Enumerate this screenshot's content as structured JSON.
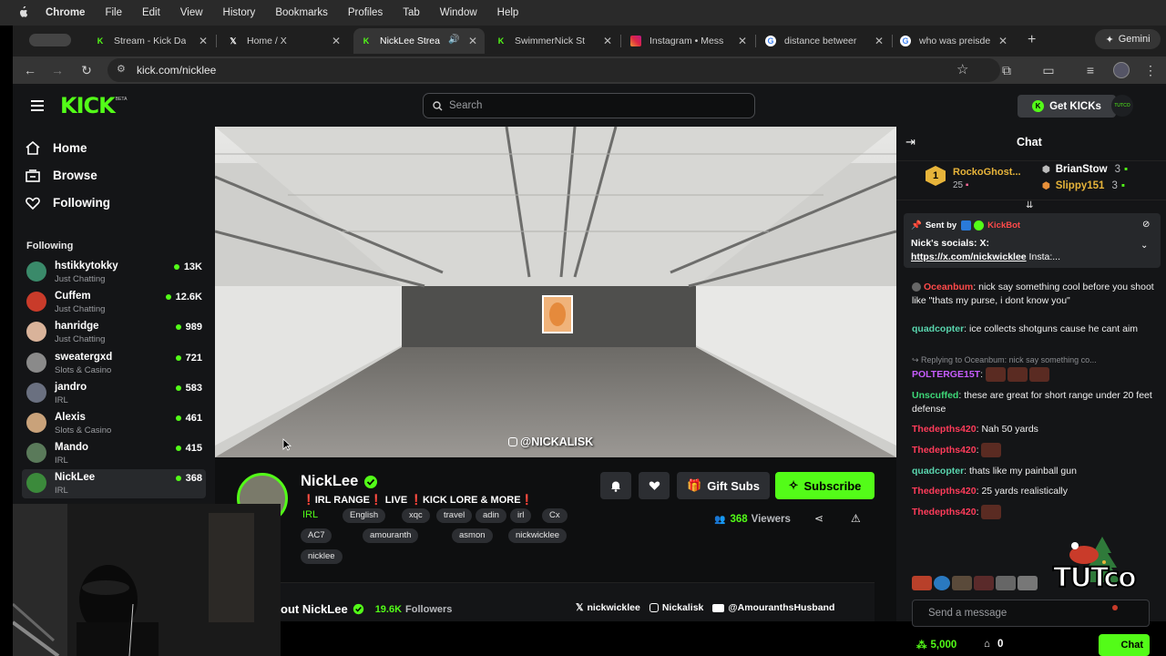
{
  "menubar": {
    "items": [
      "Chrome",
      "File",
      "Edit",
      "View",
      "History",
      "Bookmarks",
      "Profiles",
      "Tab",
      "Window",
      "Help"
    ]
  },
  "tabs": [
    {
      "title": "Stream - Kick Da",
      "icon": "kick-icon"
    },
    {
      "title": "Home / X",
      "icon": "x-icon"
    },
    {
      "title": "NickLee Strea",
      "icon": "kick-icon",
      "active": true
    },
    {
      "title": "SwimmerNick St",
      "icon": "kick-icon"
    },
    {
      "title": "Instagram • Mess",
      "icon": "instagram-icon"
    },
    {
      "title": "distance betweer",
      "icon": "google-icon"
    },
    {
      "title": "who was preisde",
      "icon": "google-icon"
    }
  ],
  "browser": {
    "url": "kick.com/nicklee",
    "gemini_label": "Gemini"
  },
  "header": {
    "logo": "KICK",
    "logo_sup": "BETA",
    "search_placeholder": "Search",
    "get_kicks": "Get KICKs",
    "avatar_text": "TUTCO"
  },
  "sidebar": {
    "nav": [
      {
        "label": "Home",
        "icon": "home-icon"
      },
      {
        "label": "Browse",
        "icon": "browse-icon"
      },
      {
        "label": "Following",
        "icon": "heart-icon"
      }
    ],
    "following_heading": "Following",
    "following": [
      {
        "name": "hstikkytokky",
        "category": "Just Chatting",
        "viewers": "13K",
        "color": "#3a8a6a"
      },
      {
        "name": "Cuffem",
        "category": "Just Chatting",
        "viewers": "12.6K",
        "color": "#c93b2a"
      },
      {
        "name": "hanridge",
        "category": "Just Chatting",
        "viewers": "989",
        "color": "#d9b39a"
      },
      {
        "name": "sweatergxd",
        "category": "Slots & Casino",
        "viewers": "721",
        "color": "#8a8a8a"
      },
      {
        "name": "jandro",
        "category": "IRL",
        "viewers": "583",
        "color": "#6a7080"
      },
      {
        "name": "Alexis",
        "category": "Slots & Casino",
        "viewers": "461",
        "color": "#c9a27a"
      },
      {
        "name": "Mando",
        "category": "IRL",
        "viewers": "415",
        "color": "#5a7a5a"
      },
      {
        "name": "NickLee",
        "category": "IRL",
        "viewers": "368",
        "color": "#3b8a3b",
        "selected": true
      }
    ]
  },
  "video": {
    "watermark": "@NICKALISK"
  },
  "channel": {
    "name": "NickLee",
    "title_parts": [
      "❗",
      "IRL RANGE",
      "❗",
      " LIVE ",
      "❗",
      "KICK LORE & MORE",
      "❗"
    ],
    "category": "IRL",
    "tags": [
      "English",
      "xqc",
      "travel",
      "adin",
      "irl",
      "Cx",
      "AC7",
      "amouranth",
      "asmon",
      "nickwicklee",
      "nicklee"
    ],
    "gift_subs": "Gift Subs",
    "subscribe": "Subscribe",
    "viewers": "368",
    "viewers_label": "Viewers",
    "about_label": "out NickLee",
    "followers": "19.6K",
    "followers_label": "Followers",
    "socials": [
      {
        "icon": "x-icon",
        "handle": "nickwicklee"
      },
      {
        "icon": "instagram-icon",
        "handle": "Nickalisk"
      },
      {
        "icon": "youtube-icon",
        "handle": "@AmouranthsHusband"
      }
    ]
  },
  "chat": {
    "title": "Chat",
    "leaderboard": {
      "rank": "1",
      "top_user": "RockoGhost...",
      "top_count": "25",
      "users": [
        {
          "name": "BrianStow",
          "count": "3"
        },
        {
          "name": "Slippy151",
          "count": "3"
        }
      ]
    },
    "pinned": {
      "sent_by": "Sent by",
      "bot": "KickBot",
      "line1": "Nick's socials: X:",
      "link": "https://x.com/nickwicklee",
      "line2_rest": " Insta:..."
    },
    "messages": [
      {
        "user": "Oceanbum",
        "color": "#ff4a4a",
        "text": "nick say something cool before you shoot like \"thats my purse, i dont know you\""
      },
      {
        "user": "quadcopter",
        "color": "#59d5ae",
        "text": "ice collects shotguns cause he cant aim"
      },
      {
        "reply": "Replying to Oceanbum: nick say something co...",
        "user": "POLTERGE15T",
        "color": "#c65cff",
        "text": ""
      },
      {
        "user": "Unscuffed",
        "color": "#3ed878",
        "text": "these are great for short range under 20 feet  defense"
      },
      {
        "user": "Thedepths420",
        "color": "#ff3c5a",
        "text": "Nah 50 yards"
      },
      {
        "user": "Thedepths420",
        "color": "#ff3c5a",
        "text": ""
      },
      {
        "user": "quadcopter",
        "color": "#59d5ae",
        "text": "thats like my painball gun"
      },
      {
        "user": "Thedepths420",
        "color": "#ff3c5a",
        "text": "25 yards realistically"
      },
      {
        "user": "Thedepths420",
        "color": "#ff3c5a",
        "text": ""
      }
    ],
    "send_placeholder": "Send a message",
    "kicks_balance": "5,000",
    "gift_count": "0",
    "chat_button": "Chat"
  },
  "overlay": {
    "logo_text": "TUTco"
  }
}
